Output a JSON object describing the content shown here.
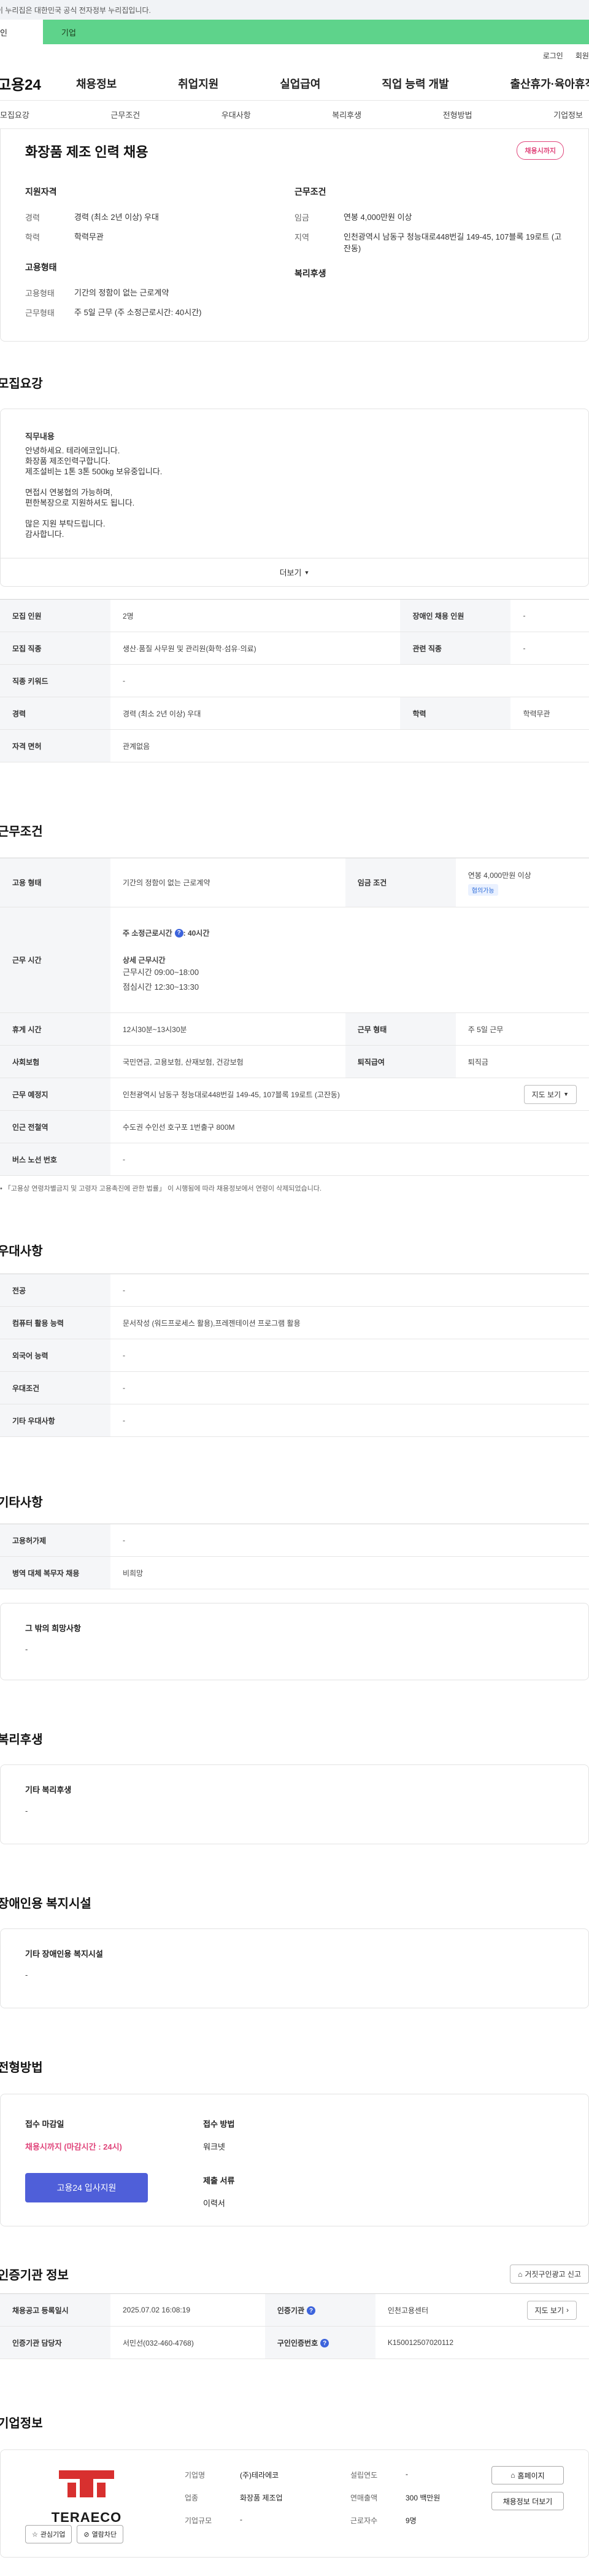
{
  "gov_banner": "이 누리집은 대한민국 공식 전자정부 누리집입니다.",
  "type_tabs": {
    "personal": "개인",
    "company": "기업"
  },
  "util": {
    "login": "로그인",
    "signup": "회원가입"
  },
  "gnb": {
    "logo": "고용24",
    "menu": [
      "채용정보",
      "취업지원",
      "실업급여",
      "직업 능력 개발",
      "출산휴가·육아휴직"
    ]
  },
  "sec_nav": [
    "모집요강",
    "근무조건",
    "우대사항",
    "복리후생",
    "전형방법",
    "기업정보"
  ],
  "summary": {
    "title": "화장품 제조 인력 채용",
    "badge": "채용시까지",
    "qual_title": "지원자격",
    "qual": [
      {
        "k": "경력",
        "v": "경력 (최소 2년 이상) 우대"
      },
      {
        "k": "학력",
        "v": "학력무관"
      }
    ],
    "emp_title": "고용형태",
    "emp": [
      {
        "k": "고용형태",
        "v": "기간의 정함이 없는 근로계약"
      },
      {
        "k": "근무형태",
        "v": "주 5일 근무 (주 소정근로시간: 40시간)"
      }
    ],
    "cond_title": "근무조건",
    "cond": [
      {
        "k": "임금",
        "v": "연봉 4,000만원 이상"
      },
      {
        "k": "지역",
        "v": "인천광역시 남동구 청능대로448번길 149-45, 107블록 19로트 (고잔동)"
      }
    ],
    "welfare_title": "복리후생"
  },
  "recruit": {
    "heading": "모집요강",
    "desc_title": "직무내용",
    "desc_lines": [
      "안녕하세요. 테라에코입니다.",
      "화장품 제조인력구합니다.",
      "제조설비는 1톤 3톤 500kg 보유중입니다.",
      "",
      "면접시 연봉협의 가능하며,",
      "편한복장으로 지원하셔도 됩니다.",
      "",
      "많은 지원 부탁드립니다.",
      "감사합니다."
    ],
    "more": "더보기",
    "rows": [
      [
        {
          "th": "모집 인원",
          "td": "2명"
        },
        {
          "th": "장애인 채용 인원",
          "td": "-"
        }
      ],
      [
        {
          "th": "모집 직종",
          "td": "생산·품질 사무원 및 관리원(화학·섬유·의료)"
        },
        {
          "th": "관련 직종",
          "td": "-"
        }
      ],
      [
        {
          "th": "직종 키워드",
          "td": "-"
        }
      ],
      [
        {
          "th": "경력",
          "td": "경력 (최소 2년 이상) 우대"
        },
        {
          "th": "학력",
          "td": "학력무관"
        }
      ],
      [
        {
          "th": "자격 면허",
          "td": "관계없음"
        }
      ]
    ]
  },
  "work": {
    "heading": "근무조건",
    "emp_type_th": "고용 형태",
    "emp_type_td": "기간의 정함이 없는 근로계약",
    "wage_th": "임금 조건",
    "wage_td": "연봉 4,000만원 이상",
    "wage_chip": "협의가능",
    "hours_th": "근무 시간",
    "hours_weekly": "주 소정근로시간",
    "hours_weekly_val": ": 40시간",
    "hours_detail_title": "상세 근무시간",
    "hours_detail_1": "근무시간 09:00~18:00",
    "hours_detail_2": "점심시간 12:30~13:30",
    "break_th": "휴게 시간",
    "break_td": "12시30분~13시30분",
    "form_th": "근무 형태",
    "form_td": "주 5일 근무",
    "ins_th": "사회보험",
    "ins_td": "국민연금, 고용보험, 산재보험, 건강보험",
    "retire_th": "퇴직급여",
    "retire_td": "퇴직금",
    "loc_th": "근무 예정지",
    "loc_td": "인천광역시 남동구 청능대로448번길 149-45, 107블록 19로트 (고잔동)",
    "map_btn": "지도 보기",
    "station_th": "인근 전철역",
    "station_td": "수도권 수인선 호구포 1번출구 800M",
    "bus_th": "버스 노선 번호",
    "bus_td": "-",
    "note": "「고용상 연령차별금지 및 고령자 고용촉진에 관한 법률」 이 시행됨에 따라 채용정보에서 연령이 삭제되었습니다."
  },
  "pref": {
    "heading": "우대사항",
    "rows": [
      {
        "th": "전공",
        "td": "-"
      },
      {
        "th": "컴퓨터 활용 능력",
        "td": "문서작성 (워드프로세스 활용),프레젠테이션 프로그램 활용"
      },
      {
        "th": "외국어 능력",
        "td": "-"
      },
      {
        "th": "우대조건",
        "td": "-"
      },
      {
        "th": "기타 우대사항",
        "td": "-"
      }
    ]
  },
  "etc": {
    "heading": "기타사항",
    "rows": [
      {
        "th": "고용허가제",
        "td": "-"
      },
      {
        "th": "병역 대체 복무자 채용",
        "td": "비희망"
      }
    ],
    "other_title": "그 밖의 희망사항",
    "other_val": "-"
  },
  "welfare": {
    "heading": "복리후생",
    "title": "기타 복리후생",
    "val": "-"
  },
  "disability": {
    "heading": "장애인용 복지시설",
    "title": "기타 장애인용 복지시설",
    "val": "-"
  },
  "selection": {
    "heading": "전형방법",
    "deadline_title": "접수 마감일",
    "deadline": "채용시까지 (마감시간 : 24시)",
    "apply": "고용24 입사지원",
    "method_title": "접수 방법",
    "method": "워크넷",
    "docs_title": "제출 서류",
    "docs": "이력서"
  },
  "agency": {
    "heading": "인증기관 정보",
    "report_btn": "거짓구인광고 신고",
    "reg_th": "채용공고 등록일시",
    "reg_td": "2025.07.02 16:08:19",
    "agency_th": "인증기관",
    "agency_td": "인천고용센터",
    "map_btn": "지도 보기",
    "manager_th": "인증기관 담당자",
    "manager_td": "서민선(032-460-4768)",
    "reqno_th": "구인인증번호",
    "reqno_td": "K150012507020112"
  },
  "company": {
    "heading": "기업정보",
    "logo_text": "TERAECO",
    "info": [
      {
        "k": "기업명",
        "v": "(주)테라에코"
      },
      {
        "k": "설립연도",
        "v": "-"
      },
      {
        "k": "업종",
        "v": "화장품 제조업"
      },
      {
        "k": "연매출액",
        "v": "300 백만원"
      },
      {
        "k": "기업규모",
        "v": "-"
      },
      {
        "k": "근로자수",
        "v": "9명"
      }
    ],
    "homepage_btn": "홈페이지",
    "more_jobs_btn": "채용정보 더보기",
    "fav_btn": "관심기업",
    "block_btn": "열람차단"
  }
}
